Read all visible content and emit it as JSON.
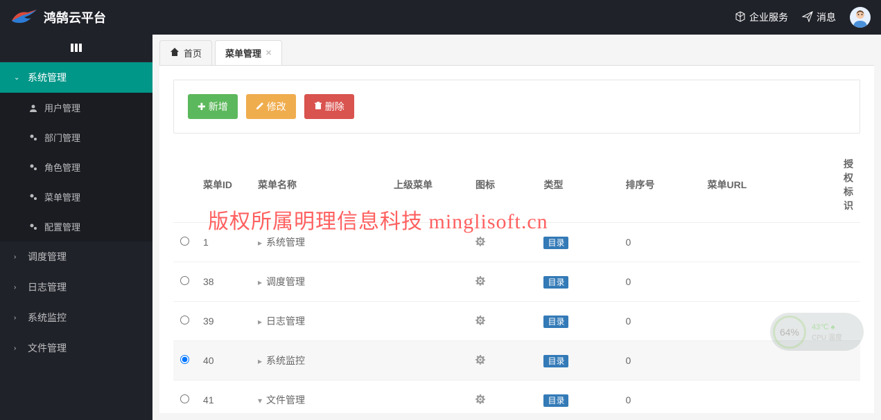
{
  "header": {
    "title": "鸿鹄云平台",
    "enterprise": "企业服务",
    "messages": "消息"
  },
  "sidebar": {
    "items": [
      {
        "label": "系统管理",
        "open": true,
        "children": [
          {
            "label": "用户管理",
            "icon": "user"
          },
          {
            "label": "部门管理",
            "icon": "cog"
          },
          {
            "label": "角色管理",
            "icon": "cog"
          },
          {
            "label": "菜单管理",
            "icon": "cog"
          },
          {
            "label": "配置管理",
            "icon": "cog"
          }
        ]
      },
      {
        "label": "调度管理",
        "open": false
      },
      {
        "label": "日志管理",
        "open": false
      },
      {
        "label": "系统监控",
        "open": false
      },
      {
        "label": "文件管理",
        "open": false
      }
    ]
  },
  "tabs": {
    "home": "首页",
    "active": "菜单管理"
  },
  "toolbar": {
    "add": "新增",
    "edit": "修改",
    "del": "删除"
  },
  "table": {
    "headers": {
      "id": "菜单ID",
      "name": "菜单名称",
      "parent": "上级菜单",
      "icon": "图标",
      "type": "类型",
      "order": "排序号",
      "url": "菜单URL",
      "auth": "授权标识"
    },
    "type_dir": "目录",
    "rows": [
      {
        "id": "1",
        "name": "系统管理",
        "parent": "",
        "order": "0",
        "expand": "right",
        "sel": false
      },
      {
        "id": "38",
        "name": "调度管理",
        "parent": "",
        "order": "0",
        "expand": "right",
        "sel": false
      },
      {
        "id": "39",
        "name": "日志管理",
        "parent": "",
        "order": "0",
        "expand": "right",
        "sel": false
      },
      {
        "id": "40",
        "name": "系统监控",
        "parent": "",
        "order": "0",
        "expand": "right",
        "sel": true
      },
      {
        "id": "41",
        "name": "文件管理",
        "parent": "",
        "order": "0",
        "expand": "down",
        "sel": false
      }
    ]
  },
  "watermark": "版权所属明理信息科技 minglisoft.cn",
  "cpu": {
    "percent": "64%",
    "temp": "43℃",
    "label": "CPU 温度"
  }
}
